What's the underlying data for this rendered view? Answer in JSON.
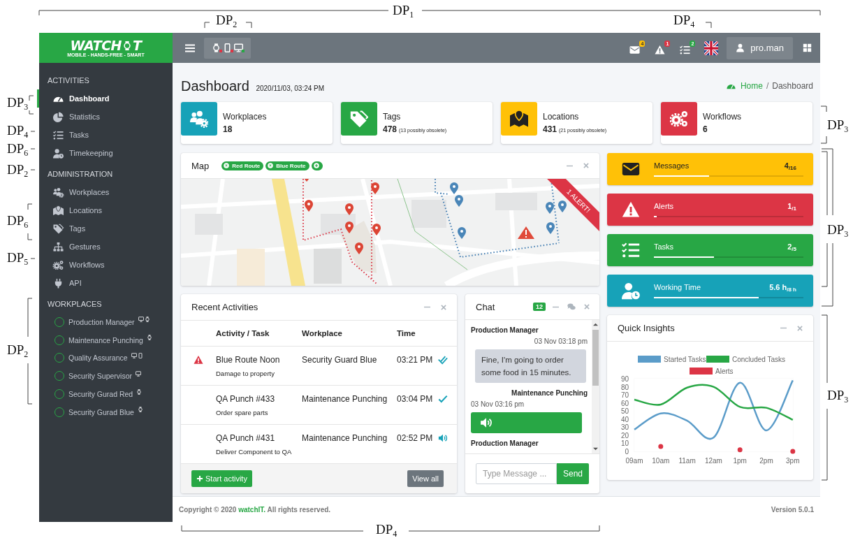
{
  "annotations": [
    {
      "text": "DP$_{1}$"
    },
    {
      "text": "DP$_{2}$"
    },
    {
      "text": "DP$_{4}$"
    },
    {
      "text": "DP$_{3}$"
    },
    {
      "text": "DP$_{4}$"
    },
    {
      "text": "DP$_{6}$"
    },
    {
      "text": "DP$_{2}$"
    },
    {
      "text": "DP$_{6}$"
    },
    {
      "text": "DP$_{5}$"
    },
    {
      "text": "DP$_{2}$"
    },
    {
      "text": "DP$_{3}$"
    },
    {
      "text": "DP$_{3}$"
    },
    {
      "text": "DP$_{3}$"
    },
    {
      "text": "DP$_{4}$"
    }
  ],
  "logo": {
    "before": "WATCH",
    "after": "T",
    "tagline": "MOBILE - HANDS-FREE - SMART"
  },
  "topbar": {
    "devices": [
      {
        "kind": "watch",
        "color": "#dc3545"
      },
      {
        "kind": "phone",
        "color": "#dc3545"
      },
      {
        "kind": "monitor",
        "color": "#28a745"
      }
    ],
    "notifications": [
      {
        "count": "4",
        "color": "#ffc107"
      },
      {
        "count": "1",
        "color": "#dc3545"
      },
      {
        "count": "2",
        "color": "#28a745"
      }
    ],
    "user": "pro.man"
  },
  "sidebar": {
    "sections": [
      {
        "title": "ACTIVITIES",
        "items": [
          {
            "label": "Dashboard",
            "selected": true
          },
          {
            "label": "Statistics",
            "selected": false
          },
          {
            "label": "Tasks",
            "selected": false
          },
          {
            "label": "Timekeeping",
            "selected": false
          }
        ]
      },
      {
        "title": "ADMINISTRATION",
        "items": [
          {
            "label": "Workplaces",
            "selected": false
          },
          {
            "label": "Locations",
            "selected": false
          },
          {
            "label": "Tags",
            "selected": false
          },
          {
            "label": "Gestures",
            "selected": false
          },
          {
            "label": "Workflows",
            "selected": false
          },
          {
            "label": "API",
            "selected": false
          }
        ]
      }
    ],
    "workplaces": {
      "title": "WORKPLACES",
      "items": [
        {
          "label": "Production Manager",
          "devices": [
            {
              "kind": "monitor"
            },
            {
              "kind": "watch"
            }
          ]
        },
        {
          "label": "Maintenance Punching",
          "devices": [
            {
              "kind": "watch"
            }
          ]
        },
        {
          "label": "Quality Assurance",
          "devices": [
            {
              "kind": "monitor"
            },
            {
              "kind": "phone"
            }
          ]
        },
        {
          "label": "Security Supervisor",
          "devices": [
            {
              "kind": "monitor"
            }
          ]
        },
        {
          "label": "Security Gurad Red",
          "devices": [
            {
              "kind": "watch"
            }
          ]
        },
        {
          "label": "Security Gurad Blue",
          "devices": [
            {
              "kind": "watch"
            }
          ]
        }
      ]
    }
  },
  "page": {
    "title": "Dashboard",
    "timestamp": "2020/11/03, 03:24 PM",
    "breadcrumb": [
      {
        "label": "Home",
        "kind": "link"
      },
      {
        "label": "Dashboard",
        "kind": "current"
      }
    ],
    "separator": "/"
  },
  "info_boxes": [
    {
      "label": "Workplaces",
      "value": "18",
      "color": "#17a2b8"
    },
    {
      "label": "Tags",
      "value": "478",
      "note": "(13 possibly obsolete)",
      "color": "#28a745"
    },
    {
      "label": "Locations",
      "value": "431",
      "note": "(21 possibly obsolete)",
      "color": "#ffc107"
    },
    {
      "label": "Workflows",
      "value": "6",
      "color": "#dc3545"
    }
  ],
  "map": {
    "title": "Map",
    "filters": [
      {
        "label": "Red Route",
        "kind": "remove"
      },
      {
        "label": "Blue Route",
        "kind": "remove"
      },
      {
        "kind": "add"
      }
    ],
    "ribbon": "1 ALERT!"
  },
  "activities": {
    "title": "Recent Activities",
    "columns": [
      "Activity / Task",
      "Workplace",
      "Time"
    ],
    "rows": [
      {
        "alert": true,
        "task": "Blue Route Noon",
        "detail": "Damage to property",
        "workplace": "Security Guard Blue",
        "time": "03:21 PM",
        "kind": "double-check"
      },
      {
        "alert": false,
        "task": "QA Punch #433",
        "detail": "Order spare parts",
        "workplace": "Maintenance Punching",
        "time": "03:04 PM",
        "kind": "check"
      },
      {
        "alert": false,
        "task": "QA Punch #431",
        "detail": "Deliver Component to QA",
        "workplace": "Maintenance Punching",
        "time": "02:52 PM",
        "kind": "audio"
      }
    ],
    "buttons": [
      {
        "label": "Start activity",
        "kind": "primary"
      },
      {
        "label": "View all",
        "kind": "secondary"
      }
    ]
  },
  "chat": {
    "title": "Chat",
    "badge": "12",
    "messages": [
      {
        "sender": "Production Manager",
        "time": "03 Nov 03:18 pm",
        "text": "Fine, I'm going to order some food in 15 minutes.",
        "own": false
      },
      {
        "sender": "Maintenance Punching",
        "time": "03 Nov 03:16 pm",
        "kind": "audio",
        "own": true
      },
      {
        "sender": "Production Manager",
        "own": false
      }
    ],
    "placeholder": "Type Message ...",
    "send": "Send"
  },
  "stat_boxes": [
    {
      "label": "Messages",
      "value": "4$_{/16}$",
      "level": 0.37,
      "color": "#ffc107"
    },
    {
      "label": "Alerts",
      "value": "1$_{/1}$",
      "level": 0.02,
      "color": "#dc3545"
    },
    {
      "label": "Tasks",
      "value": "2$_{/5}$",
      "level": 0.4,
      "color": "#28a745"
    },
    {
      "label": "Working Time",
      "value": "5.6 h$_{/8 h}$",
      "level": 0.7,
      "color": "#17a2b8"
    }
  ],
  "insights": {
    "title": "Quick Insights",
    "chart_data": {
      "type": "line",
      "categories": [
        "09am",
        "10am",
        "11am",
        "12am",
        "1pm",
        "2pm",
        "3pm"
      ],
      "yticks": [
        0,
        10,
        20,
        30,
        40,
        50,
        60,
        70,
        80,
        90
      ],
      "ylim": [
        0,
        90
      ],
      "legend": "top",
      "series": [
        {
          "name": "Started Tasks",
          "color": "#5b9cc9",
          "values": [
            27,
            47,
            38,
            17,
            85,
            26,
            88
          ]
        },
        {
          "name": "Concluded Tasks",
          "color": "#28a745",
          "values": [
            64,
            58,
            79,
            80,
            55,
            54,
            39
          ]
        },
        {
          "name": "Alerts",
          "color": "#dc3545",
          "type": "scatter",
          "values": [
            null,
            6,
            null,
            null,
            2,
            null,
            0
          ]
        }
      ]
    }
  },
  "footer": {
    "copyright": "Copyright © 2020 **watchIT.** All rights reserved.",
    "version": "Version 5.0.1"
  }
}
